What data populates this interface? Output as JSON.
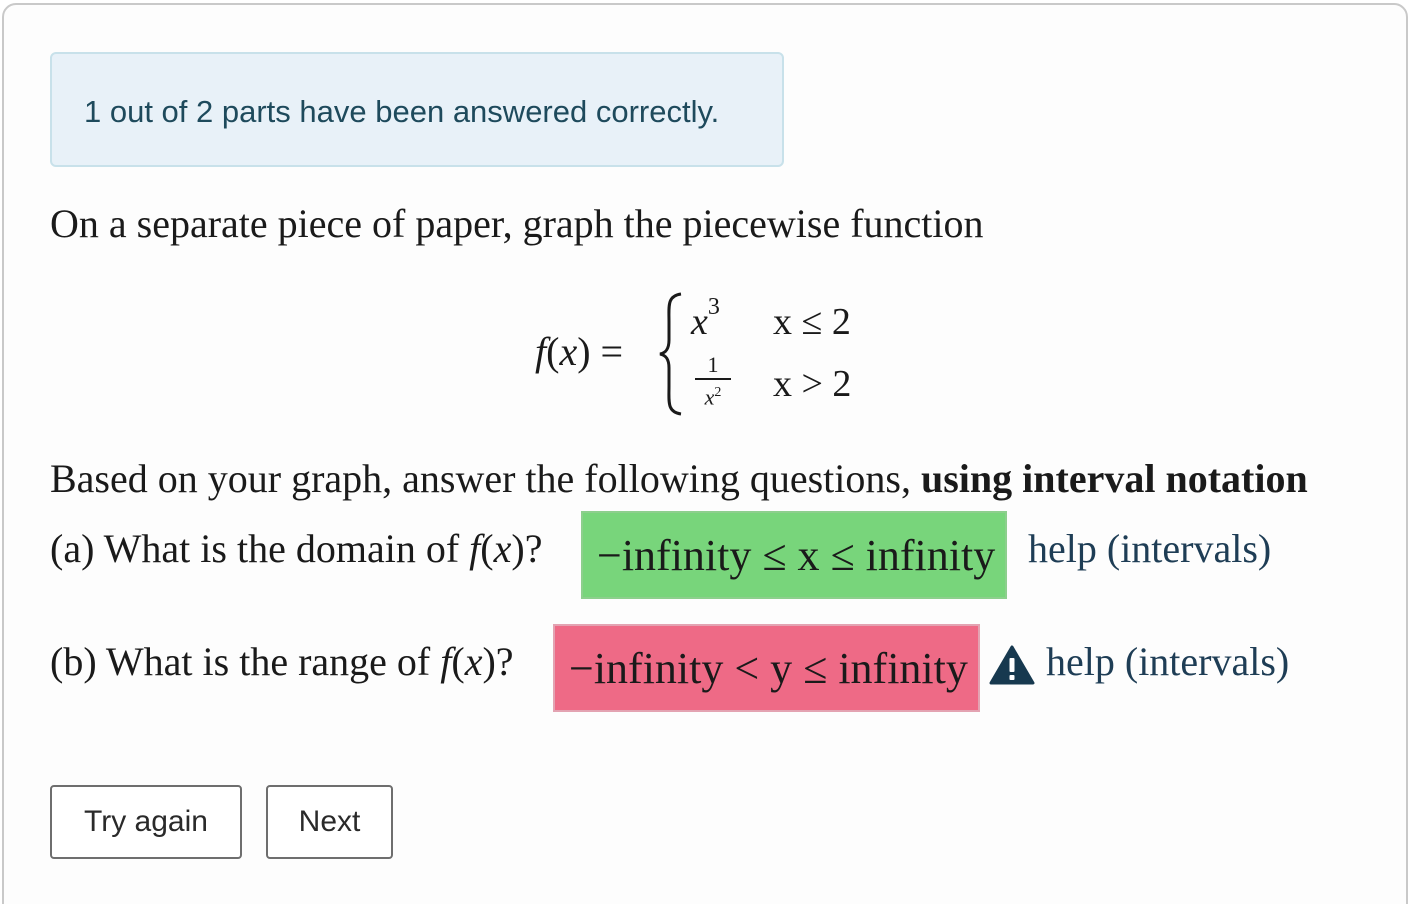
{
  "alert": {
    "message": "1 out of 2 parts have been answered correctly."
  },
  "problem": {
    "intro": "On a separate piece of paper, graph the piecewise function",
    "function": {
      "lhs_name": "f",
      "lhs_var": "x",
      "case1_expr_base": "x",
      "case1_expr_exp": "3",
      "case1_cond": "x ≤ 2",
      "case2_num": "1",
      "case2_den_base": "x",
      "case2_den_exp": "2",
      "case2_cond": "x > 2"
    },
    "instructions_prefix": "Based on your graph, answer the following questions, ",
    "instructions_bold": "using interval notation"
  },
  "questions": [
    {
      "label_prefix": "(a) What is the domain of ",
      "label_suffix": "?",
      "answer": "−infinity ≤ x ≤ infinity",
      "status": "correct",
      "status_color": "#78d57b",
      "help": "help (intervals)"
    },
    {
      "label_prefix": "(b) What is the range of ",
      "label_suffix": "?",
      "answer": "−infinity < y ≤ infinity",
      "status": "incorrect",
      "status_color": "#ee6a86",
      "warning_icon": "warning-triangle-icon",
      "help": "help (intervals)"
    }
  ],
  "buttons": {
    "try_again": "Try again",
    "next": "Next"
  }
}
